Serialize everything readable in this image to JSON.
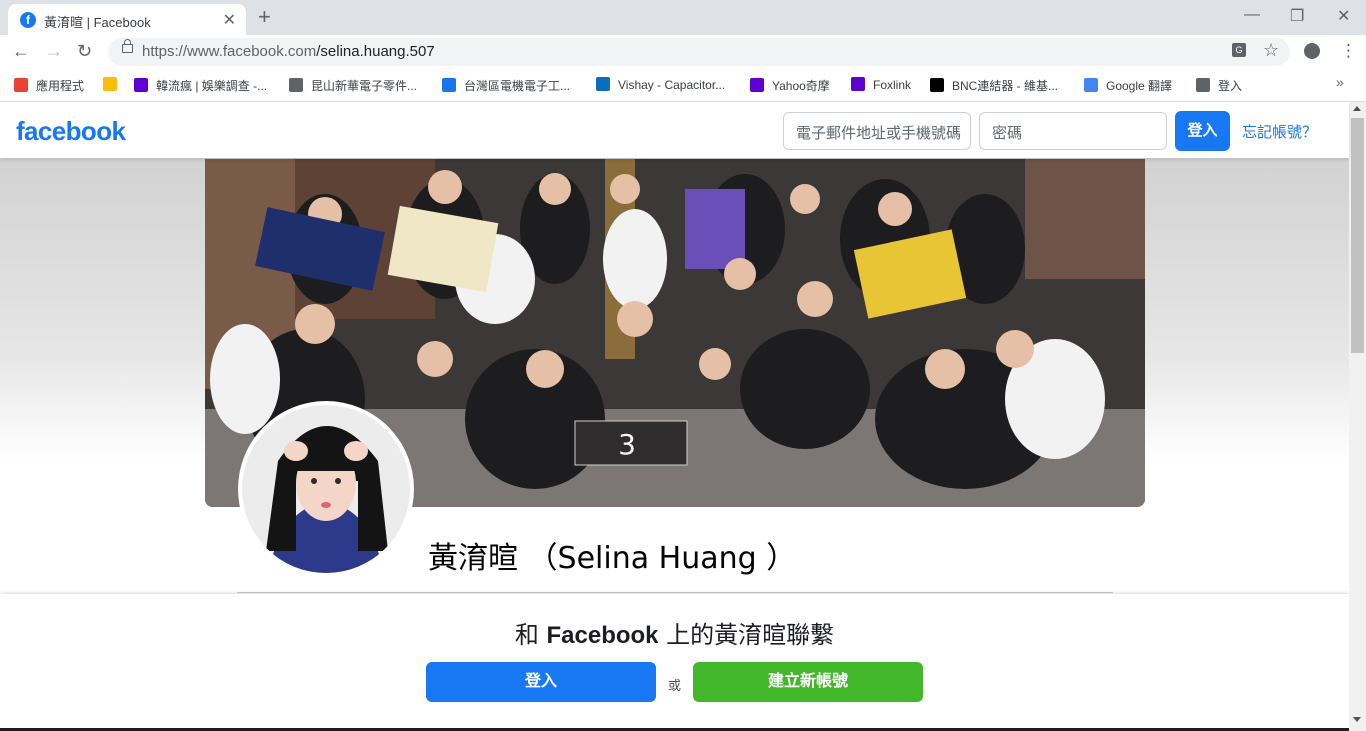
{
  "browser": {
    "tab_title": "黃淯暄 | Facebook",
    "tab_favicon_letter": "f",
    "new_tab": "+",
    "url_host": "https://www.facebook.com",
    "url_path": "/selina.huang.507",
    "bookmarks": [
      {
        "label": "應用程式",
        "icon": "apps-grid-icon",
        "color": "#ea4335"
      },
      {
        "label": "",
        "icon": "yellow-bookmark-icon",
        "color": "#fbbc05"
      },
      {
        "label": "韓流瘋 | 娛樂調查 -...",
        "icon": "yahoo-icon",
        "color": "#5f01d1"
      },
      {
        "label": "昆山新華電子零件...",
        "icon": "page-icon",
        "color": "#5f6368"
      },
      {
        "label": "台灣區電機電子工...",
        "icon": "globe-icon",
        "color": "#1a73e8"
      },
      {
        "label": "Vishay - Capacitor...",
        "icon": "vishay-icon",
        "color": "#0a6ebd"
      },
      {
        "label": "Yahoo奇摩",
        "icon": "yahoo-icon",
        "color": "#5f01d1"
      },
      {
        "label": "Foxlink",
        "icon": "yahoo-icon",
        "color": "#5f01d1"
      },
      {
        "label": "BNC連結器 - 維基...",
        "icon": "wikipedia-icon",
        "color": "#000000"
      },
      {
        "label": "Google 翻譯",
        "icon": "google-translate-icon",
        "color": "#4285f4"
      },
      {
        "label": "登入",
        "icon": "page-icon",
        "color": "#5f6368"
      }
    ]
  },
  "header": {
    "logo": "facebook",
    "email_placeholder": "電子郵件地址或手機號碼",
    "password_placeholder": "密碼",
    "login_label": "登入",
    "forgot_label": "忘記帳號？"
  },
  "profile": {
    "name": "黃淯暄 （Selina Huang ）",
    "cover_sign_number": "3"
  },
  "connect": {
    "prefix": "和 ",
    "brand": "Facebook",
    "suffix": " 上的黃淯暄聯繫",
    "login_label": "登入",
    "or_label": "或",
    "signup_label": "建立新帳號"
  },
  "colors": {
    "facebook_blue": "#1877f2",
    "signup_green": "#42b72a"
  }
}
